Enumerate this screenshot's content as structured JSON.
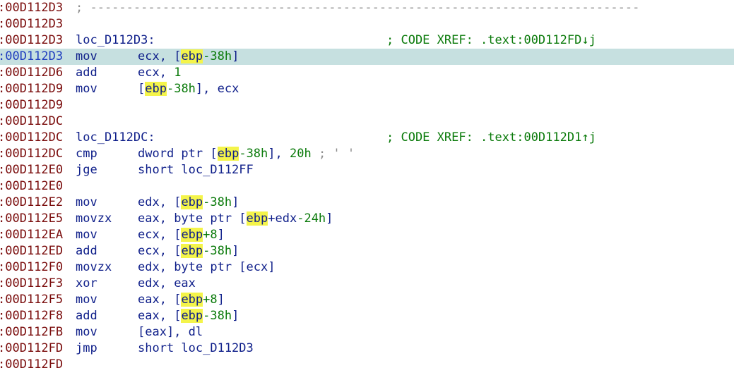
{
  "view": {
    "highlight_term": "ebp",
    "lines": [
      {
        "addr": ":00D112D3",
        "kind": "separator",
        "text": "; ----------------------------------------------------------------------------"
      },
      {
        "addr": ":00D112D3",
        "kind": "blank"
      },
      {
        "addr": ":00D112D3",
        "kind": "label",
        "label": "loc_D112D3:",
        "xref": "; CODE XREF: .text:00D112FD↓j"
      },
      {
        "addr": ":00D112D3",
        "kind": "instr",
        "current": true,
        "mnem": "mov",
        "ops": [
          {
            "t": "r",
            "v": "ecx"
          },
          {
            "t": "p",
            "v": ", ["
          },
          {
            "t": "h",
            "v": "ebp"
          },
          {
            "t": "n",
            "v": "-38h"
          },
          {
            "t": "p",
            "v": "]"
          }
        ]
      },
      {
        "addr": ":00D112D6",
        "kind": "instr",
        "mnem": "add",
        "ops": [
          {
            "t": "r",
            "v": "ecx"
          },
          {
            "t": "p",
            "v": ", "
          },
          {
            "t": "n",
            "v": "1"
          }
        ]
      },
      {
        "addr": ":00D112D9",
        "kind": "instr",
        "mnem": "mov",
        "ops": [
          {
            "t": "p",
            "v": "["
          },
          {
            "t": "h",
            "v": "ebp"
          },
          {
            "t": "n",
            "v": "-38h"
          },
          {
            "t": "p",
            "v": "], "
          },
          {
            "t": "r",
            "v": "ecx"
          }
        ]
      },
      {
        "addr": ":00D112D9",
        "kind": "blank"
      },
      {
        "addr": ":00D112DC",
        "kind": "blank"
      },
      {
        "addr": ":00D112DC",
        "kind": "label",
        "label": "loc_D112DC:",
        "xref": "; CODE XREF: .text:00D112D1↑j"
      },
      {
        "addr": ":00D112DC",
        "kind": "instr",
        "mnem": "cmp",
        "ops": [
          {
            "t": "r",
            "v": "dword ptr "
          },
          {
            "t": "p",
            "v": "["
          },
          {
            "t": "h",
            "v": "ebp"
          },
          {
            "t": "n",
            "v": "-38h"
          },
          {
            "t": "p",
            "v": "], "
          },
          {
            "t": "n",
            "v": "20h"
          },
          {
            "t": "c",
            "v": " ; ' '"
          }
        ]
      },
      {
        "addr": ":00D112E0",
        "kind": "instr",
        "mnem": "jge",
        "ops": [
          {
            "t": "r",
            "v": "short loc_D112FF"
          }
        ]
      },
      {
        "addr": ":00D112E0",
        "kind": "blank"
      },
      {
        "addr": ":00D112E2",
        "kind": "instr",
        "mnem": "mov",
        "ops": [
          {
            "t": "r",
            "v": "edx"
          },
          {
            "t": "p",
            "v": ", ["
          },
          {
            "t": "h",
            "v": "ebp"
          },
          {
            "t": "n",
            "v": "-38h"
          },
          {
            "t": "p",
            "v": "]"
          }
        ]
      },
      {
        "addr": ":00D112E5",
        "kind": "instr",
        "mnem": "movzx",
        "ops": [
          {
            "t": "r",
            "v": "eax"
          },
          {
            "t": "p",
            "v": ", byte ptr ["
          },
          {
            "t": "h",
            "v": "ebp"
          },
          {
            "t": "r",
            "v": "+edx"
          },
          {
            "t": "n",
            "v": "-24h"
          },
          {
            "t": "p",
            "v": "]"
          }
        ]
      },
      {
        "addr": ":00D112EA",
        "kind": "instr",
        "mnem": "mov",
        "ops": [
          {
            "t": "r",
            "v": "ecx"
          },
          {
            "t": "p",
            "v": ", ["
          },
          {
            "t": "h",
            "v": "ebp"
          },
          {
            "t": "n",
            "v": "+8"
          },
          {
            "t": "p",
            "v": "]"
          }
        ]
      },
      {
        "addr": ":00D112ED",
        "kind": "instr",
        "mnem": "add",
        "ops": [
          {
            "t": "r",
            "v": "ecx"
          },
          {
            "t": "p",
            "v": ", ["
          },
          {
            "t": "h",
            "v": "ebp"
          },
          {
            "t": "n",
            "v": "-38h"
          },
          {
            "t": "p",
            "v": "]"
          }
        ]
      },
      {
        "addr": ":00D112F0",
        "kind": "instr",
        "mnem": "movzx",
        "ops": [
          {
            "t": "r",
            "v": "edx"
          },
          {
            "t": "p",
            "v": ", byte ptr [ecx]"
          }
        ]
      },
      {
        "addr": ":00D112F3",
        "kind": "instr",
        "mnem": "xor",
        "ops": [
          {
            "t": "r",
            "v": "edx"
          },
          {
            "t": "p",
            "v": ", eax"
          }
        ]
      },
      {
        "addr": ":00D112F5",
        "kind": "instr",
        "mnem": "mov",
        "ops": [
          {
            "t": "r",
            "v": "eax"
          },
          {
            "t": "p",
            "v": ", ["
          },
          {
            "t": "h",
            "v": "ebp"
          },
          {
            "t": "n",
            "v": "+8"
          },
          {
            "t": "p",
            "v": "]"
          }
        ]
      },
      {
        "addr": ":00D112F8",
        "kind": "instr",
        "mnem": "add",
        "ops": [
          {
            "t": "r",
            "v": "eax"
          },
          {
            "t": "p",
            "v": ", ["
          },
          {
            "t": "h",
            "v": "ebp"
          },
          {
            "t": "n",
            "v": "-38h"
          },
          {
            "t": "p",
            "v": "]"
          }
        ]
      },
      {
        "addr": ":00D112FB",
        "kind": "instr",
        "mnem": "mov",
        "ops": [
          {
            "t": "p",
            "v": "[eax], dl"
          }
        ]
      },
      {
        "addr": ":00D112FD",
        "kind": "instr",
        "mnem": "jmp",
        "ops": [
          {
            "t": "r",
            "v": "short loc_D112D3"
          }
        ]
      },
      {
        "addr": ":00D112FD",
        "kind": "blank"
      }
    ]
  },
  "colors": {
    "address": "#7a0c0c",
    "current_address": "#1f3dbf",
    "instruction": "#0f1f8a",
    "number": "#0a7a0a",
    "comment": "#8c8c8c",
    "current_line_bg": "#c6e0e0",
    "highlight_bg": "#f4f44a"
  }
}
